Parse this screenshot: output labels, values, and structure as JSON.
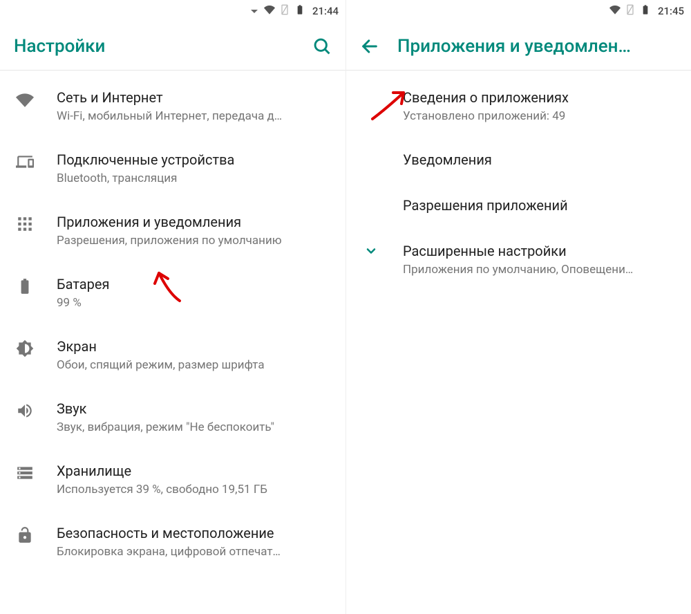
{
  "accent": "#00897b",
  "left": {
    "status_time": "21:44",
    "title": "Настройки",
    "items": [
      {
        "icon": "wifi",
        "title": "Сеть и Интернет",
        "sub": "Wi-Fi, мобильный Интернет, передача д…"
      },
      {
        "icon": "devices",
        "title": "Подключенные устройства",
        "sub": "Bluetooth, трансляция"
      },
      {
        "icon": "apps",
        "title": "Приложения и уведомления",
        "sub": "Разрешения, приложения по умолчанию"
      },
      {
        "icon": "battery",
        "title": "Батарея",
        "sub": "99 %"
      },
      {
        "icon": "brightness",
        "title": "Экран",
        "sub": "Обои, спящий режим, размер шрифта"
      },
      {
        "icon": "sound",
        "title": "Звук",
        "sub": "Звук, вибрация, режим \"Не беспокоить\""
      },
      {
        "icon": "storage",
        "title": "Хранилище",
        "sub": "Используется 39 %, свободно 19,51 ГБ"
      },
      {
        "icon": "lock",
        "title": "Безопасность и местоположение",
        "sub": "Блокировка экрана, цифровой отпечат…"
      }
    ]
  },
  "right": {
    "status_time": "21:45",
    "title": "Приложения и уведомлен…",
    "items": [
      {
        "title": "Сведения о приложениях",
        "sub": "Установлено приложений: 49"
      },
      {
        "title": "Уведомления",
        "sub": ""
      },
      {
        "title": "Разрешения приложений",
        "sub": ""
      },
      {
        "icon": "expand",
        "title": "Расширенные настройки",
        "sub": "Приложения по умолчанию, Оповещени…"
      }
    ]
  }
}
